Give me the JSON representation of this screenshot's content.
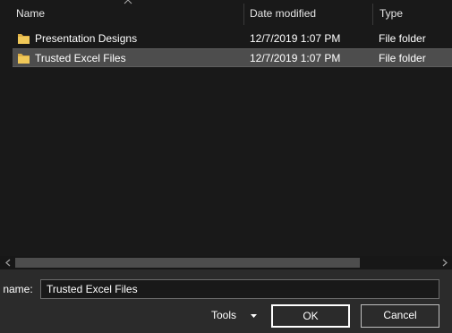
{
  "columns": {
    "name": "Name",
    "date_modified": "Date modified",
    "type": "Type"
  },
  "files": [
    {
      "name": "Presentation Designs",
      "date_modified": "12/7/2019 1:07 PM",
      "type": "File folder",
      "icon": "folder-icon",
      "selected": false
    },
    {
      "name": "Trusted Excel Files",
      "date_modified": "12/7/2019 1:07 PM",
      "type": "File folder",
      "icon": "folder-icon",
      "selected": true
    }
  ],
  "footer": {
    "file_name_label": "r name:",
    "file_name_value": "Trusted Excel Files",
    "tools_label": "Tools",
    "ok_label": "OK",
    "cancel_label": "Cancel"
  },
  "colors": {
    "background": "#191919",
    "selected_row": "#4d4d4d",
    "footer": "#2b2b2b",
    "folder": "#f0c858"
  }
}
